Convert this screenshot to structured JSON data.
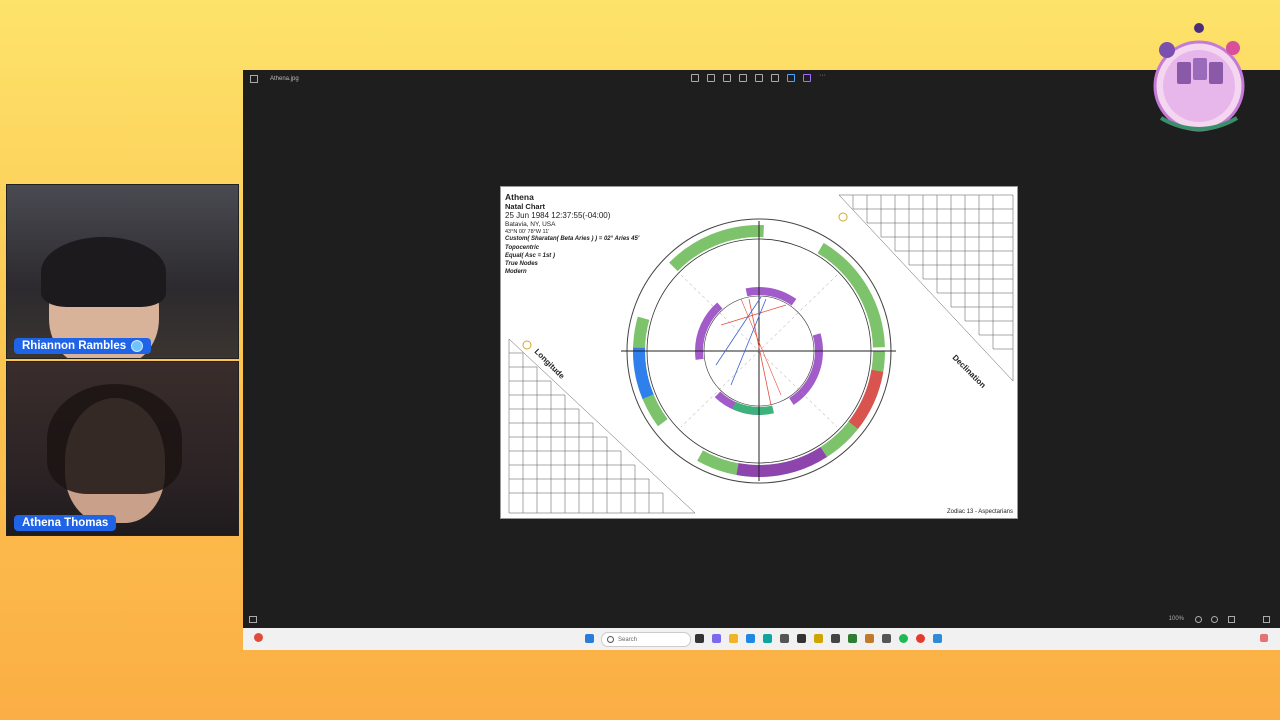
{
  "participants": [
    {
      "name": "Rhiannon Rambles"
    },
    {
      "name": "Athena Thomas"
    }
  ],
  "window": {
    "title": "Athena.jpg",
    "zoom": "100%"
  },
  "chart": {
    "name": "Athena",
    "type": "Natal Chart",
    "datetime": "25 Jun 1984 12:37:55(-04:00)",
    "location": "Batavia, NY, USA",
    "coords": "43°N 00' 78°W 11'",
    "sidereal": "Custom( Sharatan( Beta Aries ) ) = 02° Aries 45'",
    "center": "Topocentric",
    "houses": "Equal( Asc = 1st )",
    "nodes": "True Nodes",
    "style": "Modern",
    "longitude_label": "Longitude",
    "declination_label": "Declination",
    "footer": "Zodiac 13 - Aspectarians"
  },
  "taskbar": {
    "search_placeholder": "Search"
  },
  "colors": {
    "accent": "#1f63e6",
    "bg_top": "#fde36a",
    "bg_bottom": "#fbae45"
  },
  "icons": {
    "logo": "tarot-logo-icon",
    "zodiac_wheel": "zodiac-wheel-icon"
  }
}
